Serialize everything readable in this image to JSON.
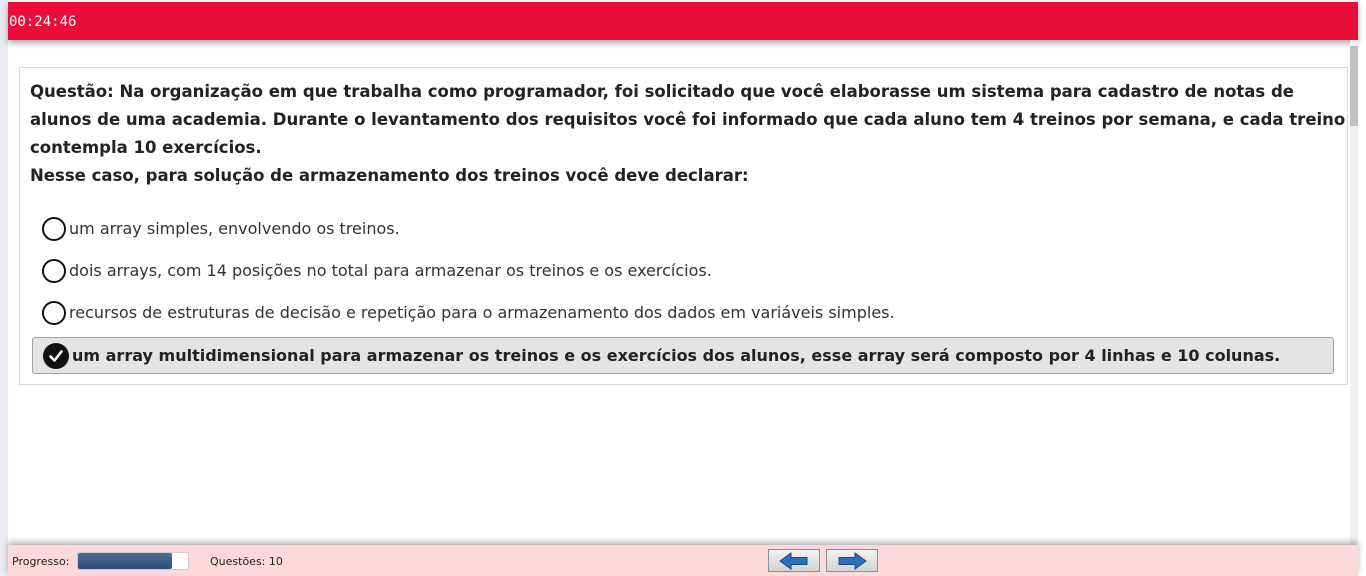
{
  "header": {
    "timer": "00:24:46",
    "background_color": "#e90d3a"
  },
  "question": {
    "text": "Questão: Na organização em que trabalha como programador, foi solicitado que você elaborasse um sistema para cadastro de notas de alunos de uma academia. Durante o levantamento dos requisitos você foi informado que cada aluno tem 4 treinos por semana, e cada treino contempla 10 exercícios.",
    "prompt": "Nesse caso, para solução de armazenamento dos treinos você deve declarar:"
  },
  "options": [
    {
      "label": "um array simples, envolvendo os treinos.",
      "selected": false
    },
    {
      "label": "dois arrays, com 14 posições no total para armazenar os treinos e os exercícios.",
      "selected": false
    },
    {
      "label": "recursos de estruturas de decisão e repetição para o armazenamento dos dados em variáveis simples.",
      "selected": false
    },
    {
      "label": "um array multidimensional para armazenar os treinos e os exercícios dos alunos, esse array será composto por 4 linhas e 10 colunas.",
      "selected": true
    }
  ],
  "footer": {
    "progress_label": "Progresso:",
    "progress_fraction": 0.85,
    "questions_label": "Questões: 10",
    "background_color": "#fdd8dc",
    "prev_icon": "arrow-left-icon",
    "next_icon": "arrow-right-icon"
  }
}
